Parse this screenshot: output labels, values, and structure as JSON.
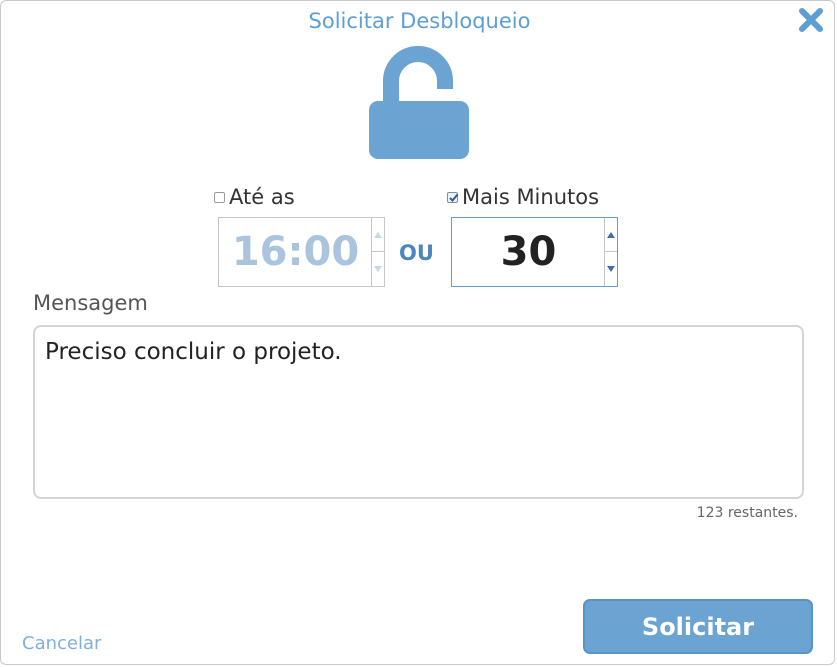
{
  "dialog": {
    "title": "Solicitar Desbloqueio",
    "close_icon": "close-icon",
    "lock_icon": "unlock-icon"
  },
  "until": {
    "label": "Até as",
    "checked": false,
    "value": "16:00"
  },
  "separator": "OU",
  "more_minutes": {
    "label": "Mais Minutos",
    "checked": true,
    "value": "30"
  },
  "message": {
    "label": "Mensagem",
    "value": "Preciso concluir o projeto.",
    "remaining": "123 restantes."
  },
  "actions": {
    "cancel_label": "Cancelar",
    "submit_label": "Solicitar"
  },
  "colors": {
    "accent": "#5d9fd3",
    "button": "#6ba3d3",
    "lock": "#6ba3d3"
  }
}
